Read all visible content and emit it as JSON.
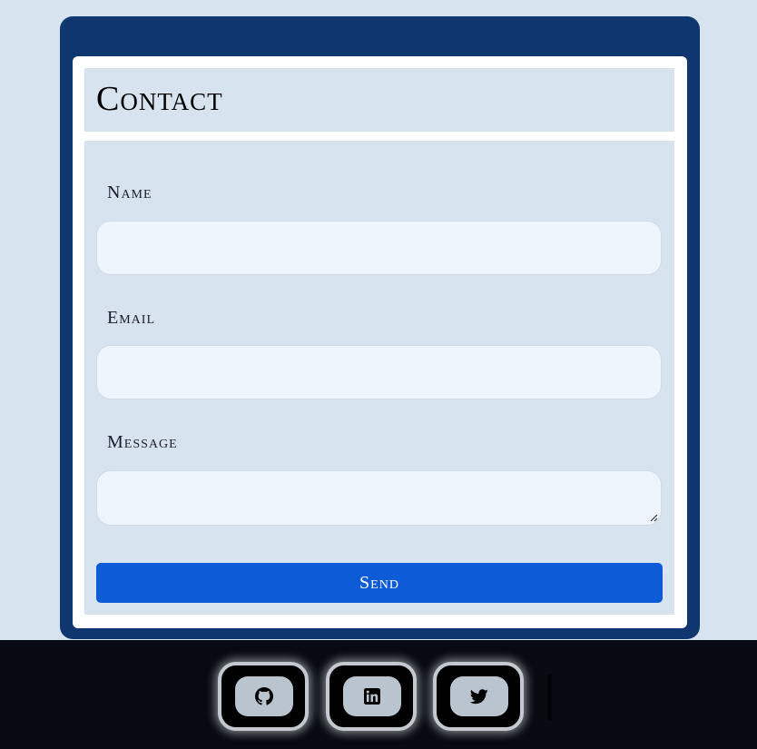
{
  "contact": {
    "title": "Contact",
    "name_label": "Name",
    "email_label": "Email",
    "message_label": "Message",
    "name_value": "",
    "email_value": "",
    "message_value": "",
    "send_label": "Send"
  },
  "footer": {
    "links": [
      {
        "icon": "github-icon"
      },
      {
        "icon": "linkedin-icon"
      },
      {
        "icon": "twitter-icon"
      }
    ]
  },
  "colors": {
    "page_bg": "#d7e3ee",
    "card_border": "#10366f",
    "field_bg": "#eef5fd",
    "send_button": "#0d5bd6",
    "footer_bg": "#070b11"
  }
}
